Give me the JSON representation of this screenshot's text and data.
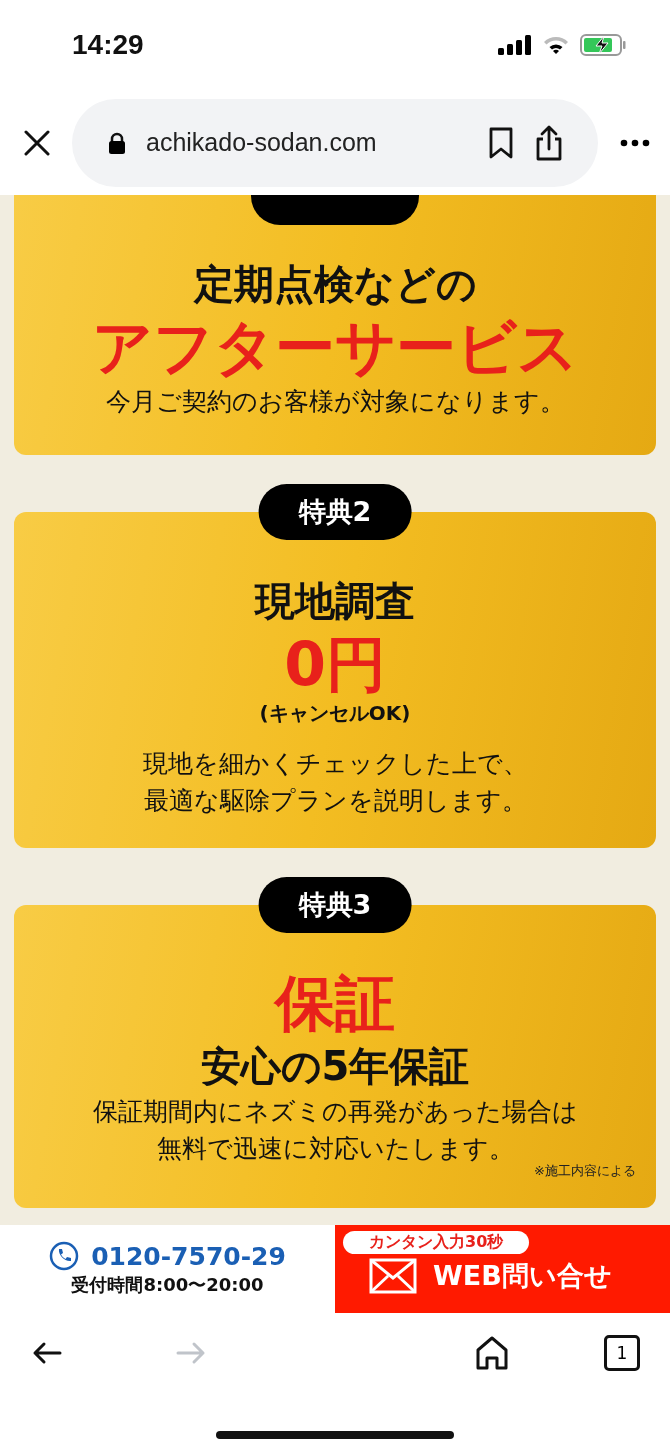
{
  "status_bar": {
    "time": "14:29",
    "charging": true
  },
  "address_bar": {
    "url": "achikado-sodan.com"
  },
  "cards": [
    {
      "lines": [
        {
          "kind": "heading",
          "text": "定期点検などの"
        },
        {
          "kind": "highlight",
          "text": "アフターサービス"
        },
        {
          "kind": "body",
          "text": "今月ご契約のお客様が対象になります。"
        }
      ]
    },
    {
      "badge": "特典2",
      "lines": [
        {
          "kind": "heading",
          "text": "現地調査"
        },
        {
          "kind": "highlight",
          "text": "0円"
        },
        {
          "kind": "note",
          "text": "(キャンセルOK)"
        },
        {
          "kind": "body",
          "text": "現地を細かくチェックした上で、"
        },
        {
          "kind": "body",
          "text": "最適な駆除プランを説明します。"
        }
      ]
    },
    {
      "badge": "特典3",
      "lines": [
        {
          "kind": "highlight",
          "text": "保証"
        },
        {
          "kind": "heading",
          "text": "安心の5年保証"
        },
        {
          "kind": "body",
          "text": "保証期間内にネズミの再発があった場合は"
        },
        {
          "kind": "body",
          "text": "無料で迅速に対応いたします。"
        }
      ],
      "footnote": "※施工内容による"
    }
  ],
  "cta": {
    "phone": "0120-7570-29",
    "hours": "受付時間8:00〜20:00",
    "tag": "カンタン入力30秒",
    "web_label": "WEB問い合せ"
  },
  "toolbar": {
    "back": {
      "disabled": false
    },
    "forward": {
      "disabled": true
    },
    "tab_count": "1"
  }
}
